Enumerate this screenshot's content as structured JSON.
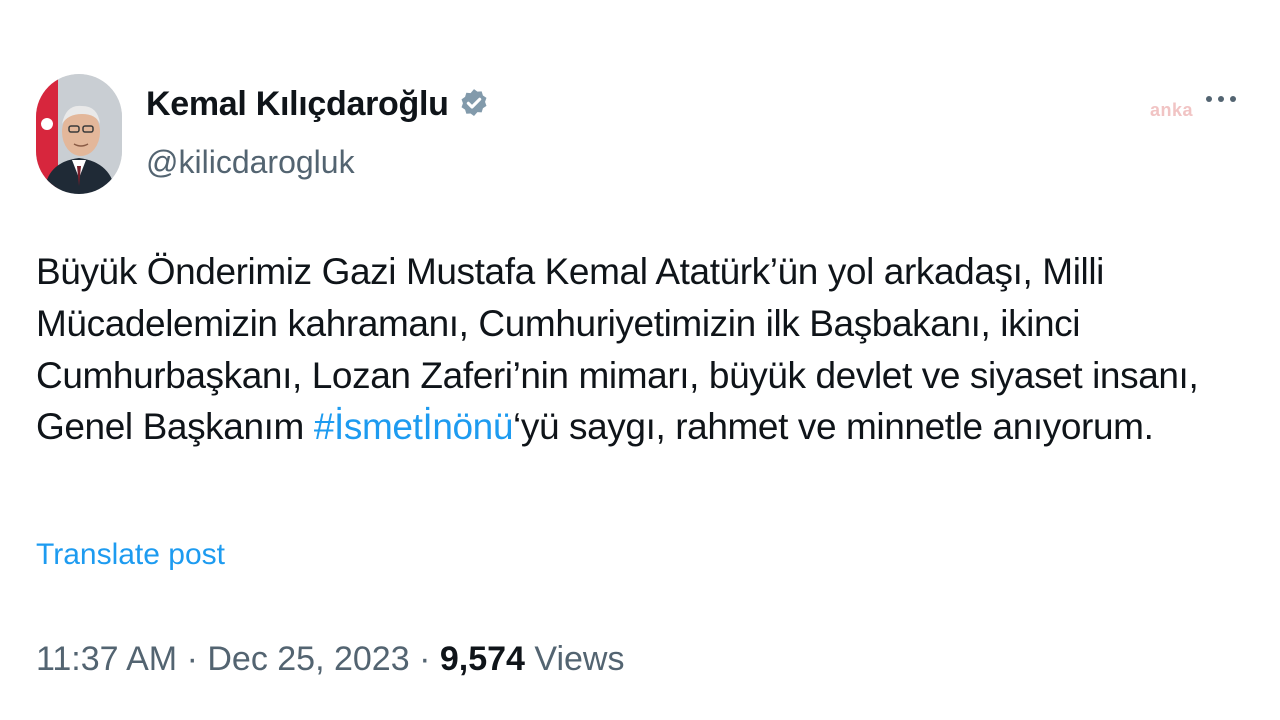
{
  "author": {
    "display_name": "Kemal Kılıçdaroğlu",
    "handle": "@kilicdarogluk",
    "verified_icon": "verified-badge-icon"
  },
  "header": {
    "watermark": "anka",
    "more_icon": "more-dots-icon"
  },
  "tweet": {
    "lines": [
      "Büyük Önderimiz Gazi Mustafa Kemal Atatürk’ün yol arkadaşı, Milli",
      "Mücadelemizin kahramanı, Cumhuriyetimizin ilk Başbakanı, ikinci",
      "Cumhurbaşkanı, Lozan Zaferi’nin mimarı, büyük devlet ve siyaset insanı,"
    ],
    "last_line_prefix": "Genel Başkanım ",
    "hashtag": "#İsmetİnönü",
    "last_line_suffix": "‘yü saygı, rahmet ve minnetle anıyorum.",
    "translate_label": "Translate post"
  },
  "meta": {
    "time": "11:37 AM",
    "separator": " · ",
    "date": "Dec 25, 2023",
    "views_count": "9,574",
    "views_label": " Views"
  },
  "colors": {
    "link": "#1d9bf0",
    "secondary_text": "#536471",
    "primary_text": "#0f1419"
  }
}
